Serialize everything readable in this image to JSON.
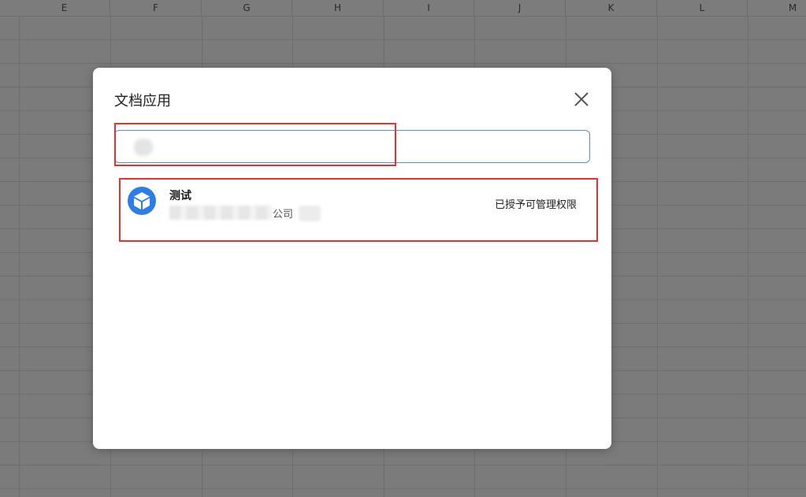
{
  "spreadsheet": {
    "columns": [
      "E",
      "F",
      "G",
      "H",
      "I",
      "J",
      "K",
      "L",
      "M"
    ]
  },
  "dialog": {
    "title": "文档应用",
    "search": {
      "value": "",
      "placeholder": ""
    },
    "apps": [
      {
        "name": "测试",
        "company": "公司",
        "status": "已授予可管理权限",
        "icon": "cube-icon"
      }
    ]
  },
  "colors": {
    "overlay": "#7b7b7b",
    "dialog_bg": "#ffffff",
    "highlight": "#e8312e",
    "search_border": "#5b8bd8",
    "icon_blue": "#2b7de9"
  }
}
